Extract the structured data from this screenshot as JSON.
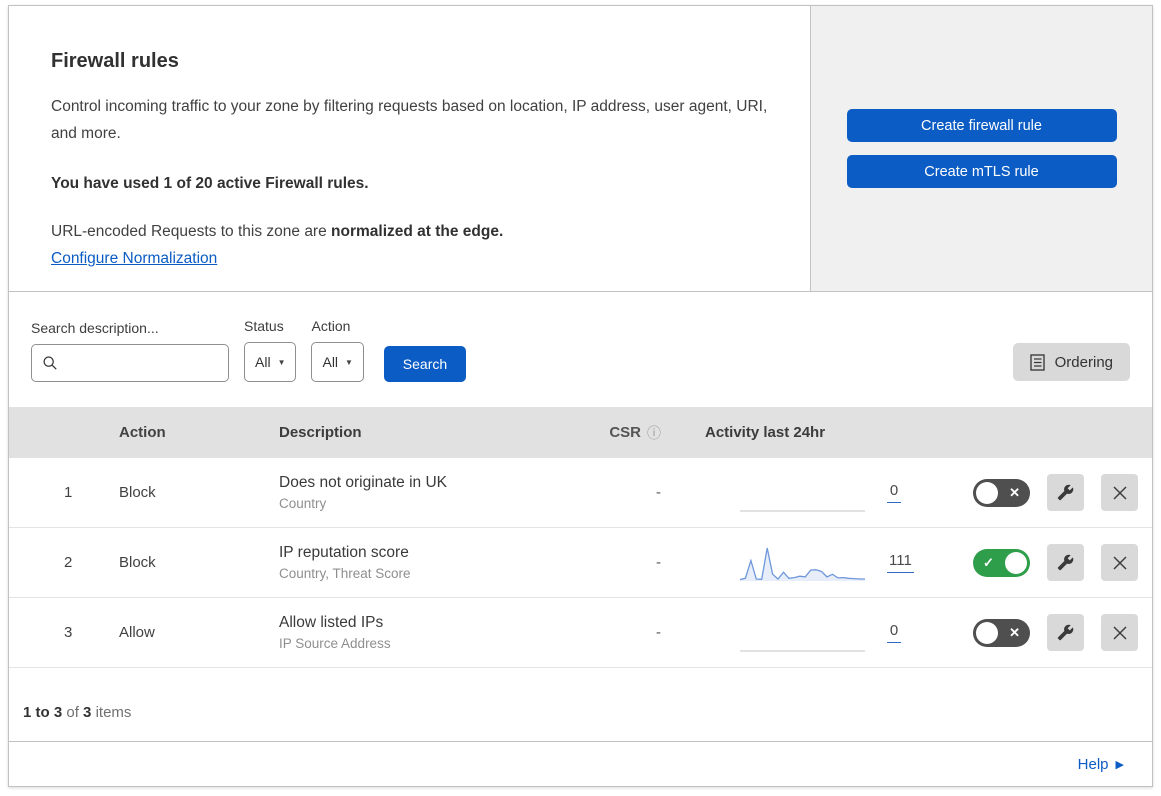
{
  "colors": {
    "accent_blue": "#0b5cc4",
    "toggle_on_green": "#2f9e4a",
    "toggle_off_gray": "#4f4f4f",
    "sparkline_blue": "#6e97dc",
    "panel_gray": "#f0f0f0",
    "table_header_gray": "#e1e1e1"
  },
  "icons": {
    "info": "ⓘ",
    "dropdown_arrow": "▼",
    "check": "✓",
    "x": "✕",
    "help_arrow": "▶"
  },
  "header": {
    "title": "Firewall rules",
    "description": "Control incoming traffic to your zone by filtering requests based on location, IP address, user agent, URI, and more.",
    "usage": "You have used 1 of 20 active Firewall rules.",
    "normalization_prefix": "URL-encoded Requests to this zone are ",
    "normalization_bold": "normalized at the edge.",
    "normalization_link": "Configure Normalization",
    "create_firewall_label": "Create firewall rule",
    "create_mtls_label": "Create mTLS rule"
  },
  "filters": {
    "search_label": "Search description...",
    "search_value": "",
    "status_label": "Status",
    "status_value": "All",
    "action_label": "Action",
    "action_value": "All",
    "search_button": "Search",
    "ordering_button": "Ordering"
  },
  "table": {
    "columns": {
      "action": "Action",
      "description": "Description",
      "csr": "CSR",
      "activity": "Activity last 24hr"
    },
    "rows": [
      {
        "priority": "1",
        "action": "Block",
        "description": "Does not originate in UK",
        "criteria": "Country",
        "csr": "-",
        "activity_count": "0",
        "enabled": false,
        "sparkline": []
      },
      {
        "priority": "2",
        "action": "Block",
        "description": "IP reputation score",
        "criteria": "Country, Threat Score",
        "csr": "-",
        "activity_count": "111",
        "enabled": true,
        "sparkline": [
          4,
          8,
          60,
          6,
          5,
          97,
          20,
          6,
          26,
          8,
          10,
          14,
          12,
          32,
          33,
          28,
          12,
          20,
          9,
          10,
          8,
          7,
          6,
          6
        ]
      },
      {
        "priority": "3",
        "action": "Allow",
        "description": "Allow listed IPs",
        "criteria": "IP Source Address",
        "csr": "-",
        "activity_count": "0",
        "enabled": false,
        "sparkline": []
      }
    ]
  },
  "footer": {
    "range": "1 to 3",
    "of_label": "of",
    "total": "3",
    "items_label": "items",
    "help_label": "Help"
  }
}
